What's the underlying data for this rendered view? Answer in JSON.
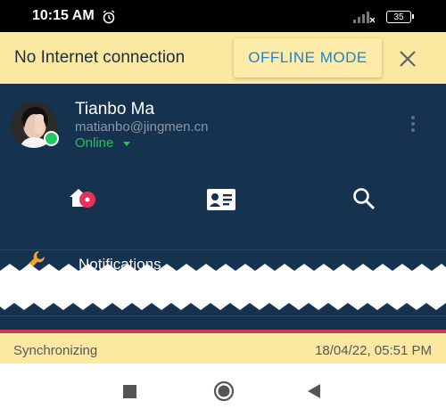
{
  "status_bar": {
    "time": "10:15 AM",
    "battery": "35"
  },
  "banner": {
    "message": "No Internet connection",
    "offline_button": "OFFLINE MODE"
  },
  "account": {
    "name": "Tianbo Ma",
    "email": "matianbo@jingmen.cn",
    "status": "Online"
  },
  "tabs": [
    {
      "icon": "home-icon"
    },
    {
      "icon": "contact-card-icon"
    },
    {
      "icon": "search-icon"
    }
  ],
  "menu": {
    "item_label": "Notifications"
  },
  "sync": {
    "status": "Synchronizing",
    "timestamp": "18/04/22, 05:51 PM"
  },
  "colors": {
    "banner_bg": "#fbe9a2",
    "panel_bg": "#15324f",
    "online": "#25c25a",
    "accent_blue": "#1f83c9",
    "accent_red": "#d33a5a"
  }
}
